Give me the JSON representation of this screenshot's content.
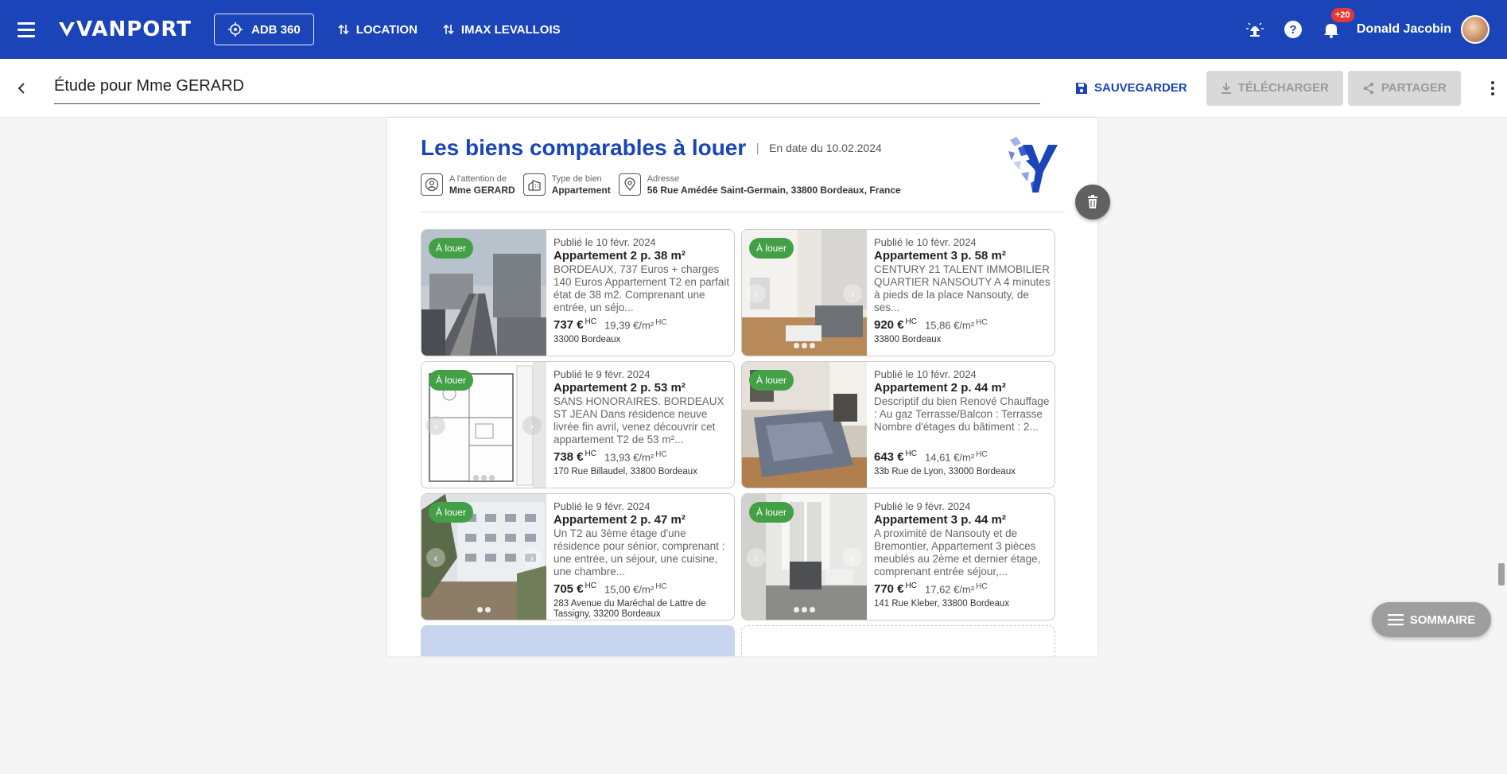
{
  "appbar": {
    "logo": "VANPORT",
    "adb_label": "ADB 360",
    "nav": [
      {
        "label": "LOCATION"
      },
      {
        "label": "IMAX LEVALLOIS"
      }
    ],
    "notif_count": "+20",
    "user_name": "Donald Jacobin"
  },
  "toolbar": {
    "title": "Étude pour Mme GERARD",
    "save_label": "SAUVEGARDER",
    "download_label": "TÉLÉCHARGER",
    "share_label": "PARTAGER"
  },
  "doc": {
    "title": "Les biens comparables à louer",
    "separator": "|",
    "date": "En date du 10.02.2024",
    "meta": [
      {
        "label": "A l'attention de",
        "value": "Mme GERARD",
        "icon": "person-icon"
      },
      {
        "label": "Type de bien",
        "value": "Appartement",
        "icon": "building-icon"
      },
      {
        "label": "Adresse",
        "value": "56 Rue Amédée Saint-Germain, 33800 Bordeaux, France",
        "icon": "location-pin-icon"
      }
    ]
  },
  "cards": [
    {
      "tag": "À louer",
      "published": "Publié le 10 févr. 2024",
      "title": "Appartement 2 p. 38 m²",
      "desc": "BORDEAUX, 737 Euros + charges 140 Euros Appartement T2 en parfait état de 38 m2. Comprenant une entrée, un séjo...",
      "price": "737 €",
      "price_suffix": "HC",
      "ppm": "19,39 €/m²",
      "ppm_suffix": "HC",
      "address": "33000 Bordeaux",
      "photo": "city-street"
    },
    {
      "tag": "À louer",
      "published": "Publié le 10 févr. 2024",
      "title": "Appartement 3 p. 58 m²",
      "desc": "CENTURY 21 TALENT IMMOBILIER QUARTIER NANSOUTY A 4 minutes à pieds de la place Nansouty, de ses...",
      "price": "920 €",
      "price_suffix": "HC",
      "ppm": "15,86 €/m²",
      "ppm_suffix": "HC",
      "address": "33800 Bordeaux",
      "photo": "living-room"
    },
    {
      "tag": "À louer",
      "published": "Publié le 9 févr. 2024",
      "title": "Appartement 2 p. 53 m²",
      "desc": "SANS HONORAIRES. BORDEAUX ST JEAN Dans résidence neuve livrée fin avril, venez découvrir cet appartement T2 de 53 m²...",
      "price": "738 €",
      "price_suffix": "HC",
      "ppm": "13,93 €/m²",
      "ppm_suffix": "HC",
      "address": "170 Rue Billaudel, 33800 Bordeaux",
      "photo": "floor-plan"
    },
    {
      "tag": "À louer",
      "published": "Publié le 10 févr. 2024",
      "title": "Appartement 2 p. 44 m²",
      "desc": "Descriptif du bien Renové Chauffage : Au gaz Terrasse/Balcon : Terrasse Nombre d'étages du bâtiment : 2...",
      "price": "643 €",
      "price_suffix": "HC",
      "ppm": "14,61 €/m²",
      "ppm_suffix": "HC",
      "address": "33b Rue de Lyon, 33000 Bordeaux",
      "photo": "bedroom"
    },
    {
      "tag": "À louer",
      "published": "Publié le 9 févr. 2024",
      "title": "Appartement 2 p. 47 m²",
      "desc": "Un T2 au 3ème étage d'une résidence pour sénior, comprenant : une entrée, un séjour, une cuisine, une chambre...",
      "price": "705 €",
      "price_suffix": "HC",
      "ppm": "15,00 €/m²",
      "ppm_suffix": "HC",
      "address": "283 Avenue du Maréchal de Lattre de Tassigny, 33200 Bordeaux",
      "photo": "building-exterior"
    },
    {
      "tag": "À louer",
      "published": "Publié le 9 févr. 2024",
      "title": "Appartement 3 p. 44 m²",
      "desc": "A proximité de Nansouty et de Bremontier, Appartement 3 pièces meublés au 2ème et dernier étage, comprenant entrée séjour,...",
      "price": "770 €",
      "price_suffix": "HC",
      "ppm": "17,62 €/m²",
      "ppm_suffix": "HC",
      "address": "141 Rue Kleber, 33800 Bordeaux",
      "photo": "bright-room"
    }
  ],
  "fab": {
    "summary_label": "SOMMAIRE"
  },
  "colors": {
    "primary": "#1a44b8",
    "tag_green": "#43a047",
    "badge_red": "#e53935"
  }
}
